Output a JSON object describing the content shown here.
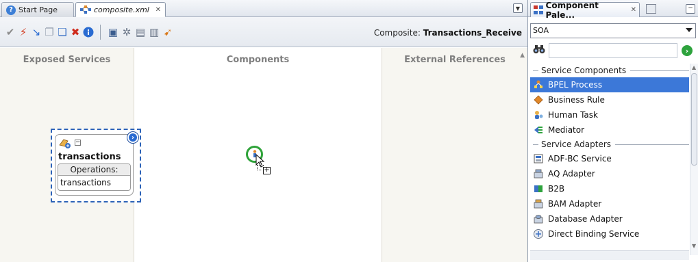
{
  "tabs": {
    "start_page": "Start Page",
    "composite": "composite.xml"
  },
  "toolbar": {
    "composite_prefix": "Composite:",
    "composite_name": "Transactions_Receive",
    "icons": [
      "validate-icon",
      "deploy-icon",
      "wire-icon",
      "copy-icon",
      "paste-icon",
      "delete-icon",
      "info-icon",
      "test-icon",
      "settings-icon",
      "properties-icon",
      "export-icon",
      "run-icon"
    ]
  },
  "lanes": {
    "exposed": "Exposed Services",
    "components": "Components",
    "references": "External References"
  },
  "service": {
    "name": "transactions",
    "operations_label": "Operations:",
    "operation": "transactions"
  },
  "palette": {
    "title": "Component Pale...",
    "category": "SOA",
    "groups": [
      {
        "label": "Service Components",
        "items": [
          {
            "label": "BPEL Process",
            "icon": "bpel-process-icon",
            "selected": true
          },
          {
            "label": "Business Rule",
            "icon": "business-rule-icon"
          },
          {
            "label": "Human Task",
            "icon": "human-task-icon"
          },
          {
            "label": "Mediator",
            "icon": "mediator-icon"
          }
        ]
      },
      {
        "label": "Service Adapters",
        "items": [
          {
            "label": "ADF-BC Service",
            "icon": "adf-bc-icon"
          },
          {
            "label": "AQ Adapter",
            "icon": "aq-adapter-icon"
          },
          {
            "label": "B2B",
            "icon": "b2b-icon"
          },
          {
            "label": "BAM Adapter",
            "icon": "bam-adapter-icon"
          },
          {
            "label": "Database Adapter",
            "icon": "database-adapter-icon"
          },
          {
            "label": "Direct Binding Service",
            "icon": "direct-binding-icon"
          }
        ]
      }
    ]
  },
  "colors": {
    "selection": "#3c78d8",
    "lane_bg": "#f7f6f1",
    "service_border": "#2d63b8",
    "drop_ring": "#2fa33a"
  }
}
